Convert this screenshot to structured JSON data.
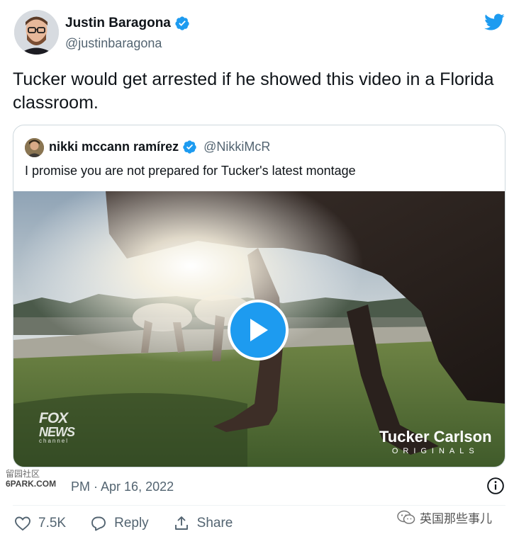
{
  "tweet": {
    "author": {
      "name": "Justin Baragona",
      "handle": "@justinbaragona"
    },
    "text": "Tucker would get arrested if he showed this video in a Florida classroom.",
    "time_fragment": "PM",
    "date": "Apr 16, 2022"
  },
  "quoted": {
    "author": {
      "name": "nikki mccann ramírez",
      "handle": "@NikkiMcR"
    },
    "text": "I promise you are not prepared for Tucker's latest montage"
  },
  "video": {
    "corner_logo": {
      "line1": "FOX",
      "line2": "NEWS",
      "line3": "channel"
    },
    "brand": {
      "title": "Tucker Carlson",
      "subtitle": "ORIGINALS"
    }
  },
  "actions": {
    "likes": "7.5K",
    "reply_label": "Reply",
    "share_label": "Share"
  },
  "watermarks": {
    "left_top": "留园社区",
    "left_bottom": "6PARK.COM",
    "right": "英国那些事儿"
  },
  "colors": {
    "accent": "#1d9bf0",
    "text": "#0f1419",
    "muted": "#536471",
    "border": "#cfd9de"
  },
  "icons": [
    "verified-badge-icon",
    "twitter-bird-icon",
    "play-icon",
    "info-icon",
    "heart-icon",
    "reply-icon",
    "share-icon",
    "wechat-icon"
  ]
}
